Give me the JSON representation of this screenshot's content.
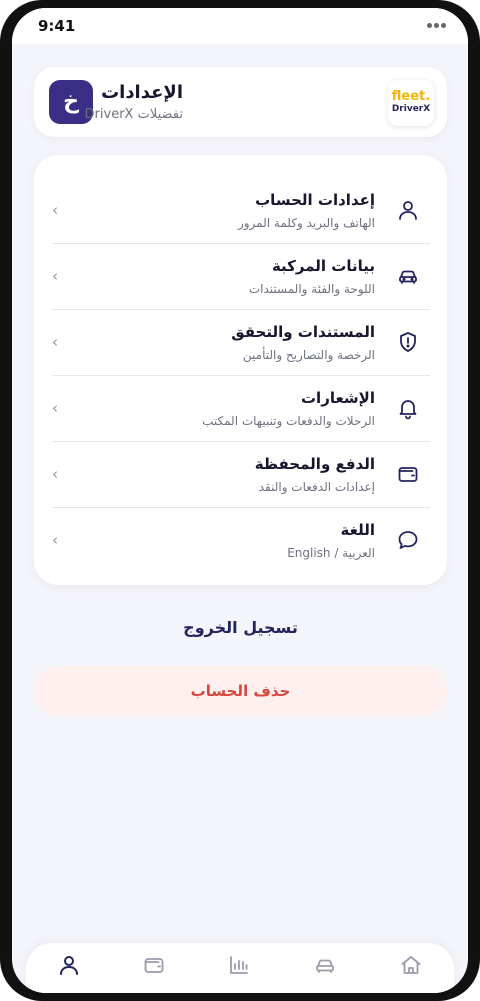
{
  "status_bar": {
    "time": "9:41"
  },
  "header": {
    "title": "الإعدادات",
    "subtitle": "تفضيلات DriverX",
    "avatar_letter": "خ",
    "logo": {
      "line1": "fleet.",
      "line2": "DriverX"
    }
  },
  "settings": {
    "items": [
      {
        "title": "إعدادات الحساب",
        "subtitle": "الهاتف والبريد وكلمة المرور",
        "icon": "user-icon"
      },
      {
        "title": "بيانات المركبة",
        "subtitle": "اللوحة والفئة والمستندات",
        "icon": "car-icon"
      },
      {
        "title": "المستندات والتحقق",
        "subtitle": "الرخصة والتصاريح والتأمين",
        "icon": "shield-alert-icon"
      },
      {
        "title": "الإشعارات",
        "subtitle": "الرحلات والدفعات وتنبيهات المكتب",
        "icon": "bell-icon"
      },
      {
        "title": "الدفع والمحفظة",
        "subtitle": "إعدادات الدفعات والنقد",
        "icon": "wallet-icon"
      },
      {
        "title": "اللغة",
        "subtitle": "العربية / English",
        "icon": "chat-bubble-icon"
      }
    ],
    "chevron": "‹"
  },
  "actions": {
    "logout": "تسجيل الخروج",
    "delete_account": "حذف الحساب"
  },
  "bottom_nav": {
    "items": [
      {
        "icon": "profile-icon",
        "active": true
      },
      {
        "icon": "wallet-icon",
        "active": false
      },
      {
        "icon": "chart-icon",
        "active": false
      },
      {
        "icon": "car-icon",
        "active": false
      },
      {
        "icon": "home-icon",
        "active": false
      }
    ]
  },
  "colors": {
    "accent": "#3a2d86",
    "brand_yellow": "#f5b400",
    "danger": "#d6473e",
    "danger_bg": "#fdf0ee",
    "background": "#f4f5fa",
    "active_nav": "#23245e",
    "inactive_nav": "#9a9cab"
  }
}
